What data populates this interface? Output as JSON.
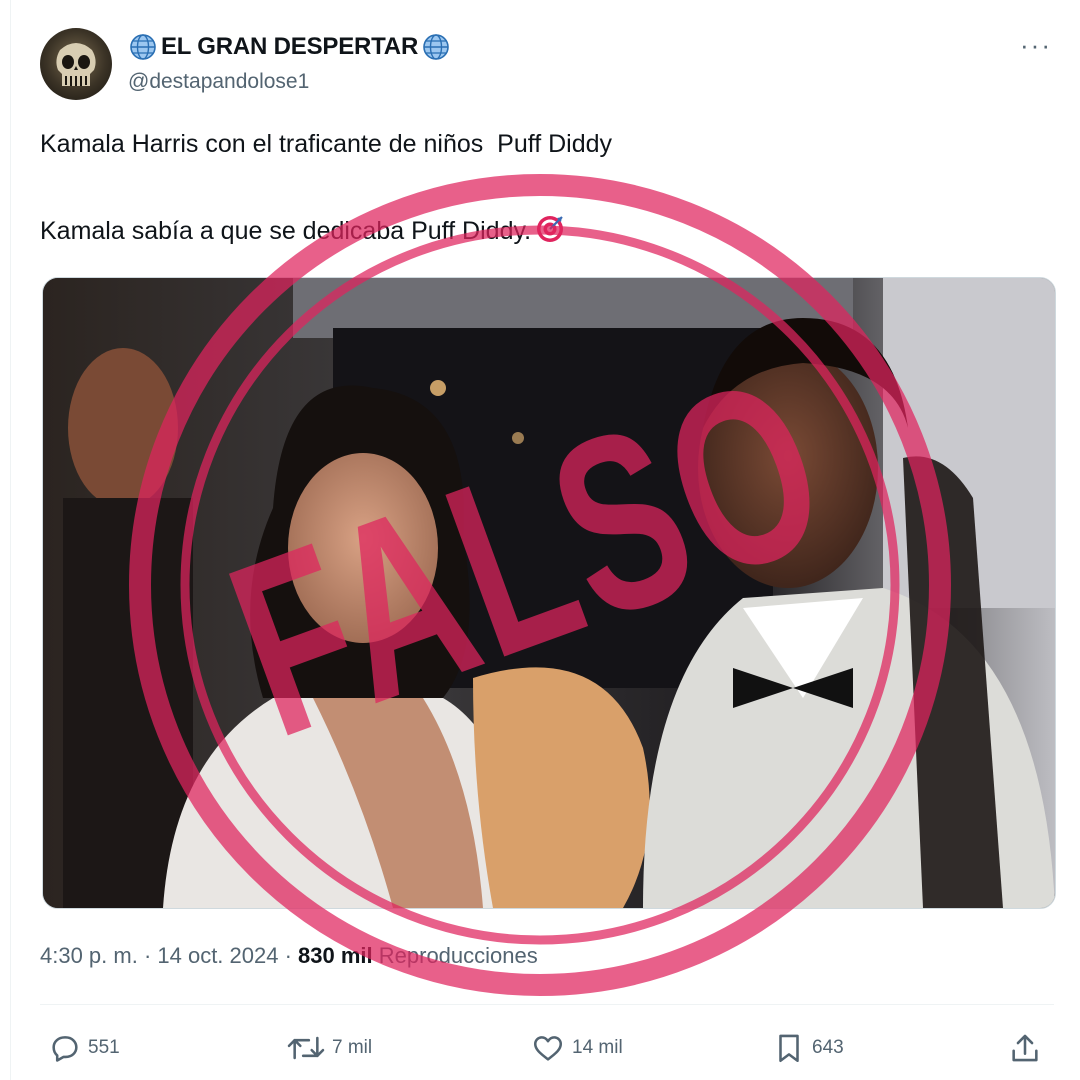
{
  "author": {
    "display_name": "EL GRAN DESPERTAR",
    "handle": "@destapandolose1"
  },
  "more_menu": "···",
  "tweet": {
    "line1": "Kamala Harris con el traficante de niños  Puff Diddy",
    "line2": "Kamala sabía a que se dedicaba Puff Diddy."
  },
  "meta": {
    "time": "4:30 p. m. · 14 oct. 2024 · ",
    "views_count": "830 mil",
    "views_label": " Reproducciones"
  },
  "actions": {
    "replies": "551",
    "retweets": "7 mil",
    "likes": "14 mil",
    "bookmarks": "643"
  },
  "stamp": {
    "text": "FALSO",
    "color": "#e0245e"
  },
  "colors": {
    "secondary_text": "#536471",
    "primary_text": "#0f1419",
    "border": "#eff3f4"
  },
  "icons": [
    "globe-icon",
    "more-icon",
    "target-emoji-icon",
    "reply-icon",
    "retweet-icon",
    "like-icon",
    "bookmark-icon",
    "share-icon"
  ]
}
